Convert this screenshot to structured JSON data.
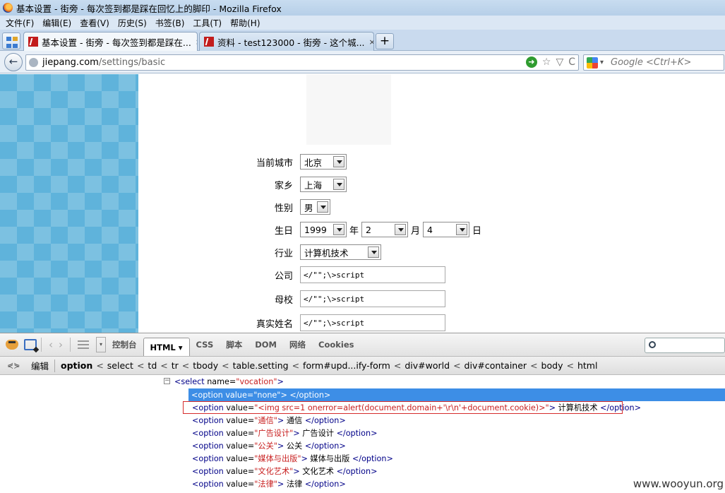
{
  "window": {
    "title": "基本设置 - 街旁 - 每次签到都是踩在回忆上的脚印 - Mozilla Firefox"
  },
  "menu": [
    "文件(F)",
    "编辑(E)",
    "查看(V)",
    "历史(S)",
    "书签(B)",
    "工具(T)",
    "帮助(H)"
  ],
  "tabs": [
    {
      "label": "基本设置 - 街旁 - 每次签到都是踩在...",
      "close": "×"
    },
    {
      "label": "资料 - test123000 - 街旁 - 这个城...",
      "close": "×"
    }
  ],
  "new_tab": "+",
  "nav": {
    "back": "←",
    "url_host": "jiepang.com",
    "url_path": "/settings/basic",
    "go": "➜",
    "star": "☆",
    "dropdown": "▽",
    "reload": "C",
    "search_engine": "▾",
    "search_placeholder": "Google <Ctrl+K>"
  },
  "form": {
    "city": {
      "label": "当前城市",
      "value": "北京"
    },
    "hometown": {
      "label": "家乡",
      "value": "上海"
    },
    "gender": {
      "label": "性别",
      "value": "男"
    },
    "birthday": {
      "label": "生日",
      "year": "1999",
      "year_unit": "年",
      "month": "2",
      "month_unit": "月",
      "day": "4",
      "day_unit": "日"
    },
    "industry": {
      "label": "行业",
      "value": "计算机技术"
    },
    "company": {
      "label": "公司",
      "value": "</\"\";\\>script"
    },
    "school": {
      "label": "母校",
      "value": "</\"\";\\>script"
    },
    "realname": {
      "label": "真实姓名",
      "value": "</\"\";\\>script"
    }
  },
  "firebug": {
    "nav_back": "‹",
    "nav_fwd": "›",
    "dropdown": "▾",
    "tabs": [
      "控制台",
      "HTML ▾",
      "CSS",
      "脚本",
      "DOM",
      "网络",
      "Cookies"
    ],
    "crumb_toggle": "⋞⋟",
    "edit_label": "编辑",
    "crumbs": [
      "option",
      "select",
      "td",
      "tr",
      "tbody",
      "table.setting",
      "form#upd...ify-form",
      "div#world",
      "div#container",
      "body",
      "html"
    ],
    "crumb_sep": "<",
    "tree": {
      "toggle": "−",
      "select_open": "<select",
      "select_attr": "name=",
      "select_val": "\"vocation\"",
      "select_close": ">",
      "options": [
        {
          "open": "<option",
          "attr": "value=",
          "val": "\"none\"",
          "close": ">",
          "text": "",
          "end": "</option>"
        },
        {
          "open": "<option",
          "attr": "value=",
          "val": "\"<img src=1 onerror=alert(document.domain+'\\r\\n'+document.cookie)>\"",
          "close": ">",
          "text": "计算机技术",
          "end": "</option>"
        },
        {
          "open": "<option",
          "attr": "value=",
          "val": "\"通信\"",
          "close": ">",
          "text": "通信",
          "end": "</option>"
        },
        {
          "open": "<option",
          "attr": "value=",
          "val": "\"广告设计\"",
          "close": ">",
          "text": "广告设计",
          "end": "</option>"
        },
        {
          "open": "<option",
          "attr": "value=",
          "val": "\"公关\"",
          "close": ">",
          "text": "公关",
          "end": "</option>"
        },
        {
          "open": "<option",
          "attr": "value=",
          "val": "\"媒体与出版\"",
          "close": ">",
          "text": "媒体与出版",
          "end": "</option>"
        },
        {
          "open": "<option",
          "attr": "value=",
          "val": "\"文化艺术\"",
          "close": ">",
          "text": "文化艺术",
          "end": "</option>"
        },
        {
          "open": "<option",
          "attr": "value=",
          "val": "\"法律\"",
          "close": ">",
          "text": "法律",
          "end": "</option>"
        }
      ]
    }
  },
  "watermark": "www.wooyun.org"
}
